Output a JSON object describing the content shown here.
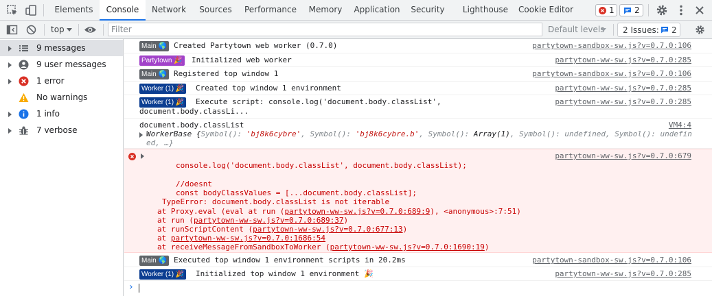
{
  "tabs": [
    "Elements",
    "Console",
    "Network",
    "Sources",
    "Performance",
    "Memory",
    "Application",
    "Security",
    "Lighthouse",
    "Cookie Editor"
  ],
  "active_tab": "Console",
  "top_counts": {
    "errors": "1",
    "messages": "2"
  },
  "toolbar": {
    "context": "top",
    "filter_placeholder": "Filter",
    "levels": "Default levels",
    "issues_label": "2 Issues:",
    "issues_count": "2"
  },
  "sidebar": {
    "items": [
      {
        "label": "9 messages",
        "icon": "list-icon"
      },
      {
        "label": "9 user messages",
        "icon": "user-icon"
      },
      {
        "label": "1 error",
        "icon": "error-icon"
      },
      {
        "label": "No warnings",
        "icon": "warning-icon"
      },
      {
        "label": "1 info",
        "icon": "info-icon"
      },
      {
        "label": "7 verbose",
        "icon": "bug-icon"
      }
    ]
  },
  "console": {
    "rows": [
      {
        "badge": "Main 🌎",
        "text": "Created Partytown web worker (0.7.0)",
        "source": "partytown-sandbox-sw.js?v=0.7.0:106"
      },
      {
        "badge": "Partytown 🎉",
        "text": "Initialized web worker",
        "source": "partytown-ww-sw.js?v=0.7.0:285"
      },
      {
        "badge": "Main 🌎",
        "text": "Registered top window 1",
        "source": "partytown-sandbox-sw.js?v=0.7.0:106"
      },
      {
        "badge": "Worker (1) 🎉",
        "text": "Created top window 1 environment",
        "source": "partytown-ww-sw.js?v=0.7.0:285"
      },
      {
        "badge": "Worker (1) 🎉",
        "text": "Execute script: console.log('document.body.classList',",
        "text2": "document.body.classLi...",
        "source": "partytown-ww-sw.js?v=0.7.0:285"
      },
      {
        "text": "document.body.classList",
        "source": "VM4:4",
        "obj_prefix": "WorkerBase {",
        "obj_k1": "Symbol(): ",
        "obj_v1": "'bj8k6cybre'",
        "obj_k2": ", Symbol(): ",
        "obj_v2": "'bj8k6cybre.b'",
        "obj_k3": ", Symbol(): ",
        "obj_v3": "Array(1)",
        "obj_k4": ", Symbol(): ",
        "obj_v4": "undefined",
        "obj_k5": ", Symbol(): ",
        "obj_v5": "undefin",
        "obj_line2": "ed, …}"
      },
      {
        "error": true,
        "source": "partytown-ww-sw.js?v=0.7.0:679",
        "lines": [
          "console.log('document.body.classList', document.body.classList);",
          "",
          "//doesnt",
          "const bodyClassValues = [...document.body.classList];"
        ],
        "type_error": "TypeError: document.body.classList is not iterable",
        "stack": [
          {
            "pre": "at Proxy.eval (eval at run (",
            "link": "partytown-ww-sw.js?v=0.7.0:689:9",
            "post": "), <anonymous>:7:51)"
          },
          {
            "pre": "at run (",
            "link": "partytown-ww-sw.js?v=0.7.0:689:37",
            "post": ")"
          },
          {
            "pre": "at runScriptContent (",
            "link": "partytown-ww-sw.js?v=0.7.0:677:13",
            "post": ")"
          },
          {
            "pre": "at ",
            "link": "partytown-ww-sw.js?v=0.7.0:1686:54",
            "post": ""
          },
          {
            "pre": "at receiveMessageFromSandboxToWorker (",
            "link": "partytown-ww-sw.js?v=0.7.0:1690:19",
            "post": ")"
          }
        ]
      },
      {
        "badge": "Main 🌎",
        "text": "Executed top window 1 environment scripts in 20.2ms",
        "source": "partytown-sandbox-sw.js?v=0.7.0:106"
      },
      {
        "badge": "Worker (1) 🎉",
        "text": "Initialized top window 1 environment 🎉",
        "source": "partytown-ww-sw.js?v=0.7.0:285"
      }
    ],
    "prompt_symbol": "›"
  },
  "colors": {
    "error_bg": "#fff0f0",
    "error_text": "#c80000",
    "accent": "#1a73e8"
  }
}
